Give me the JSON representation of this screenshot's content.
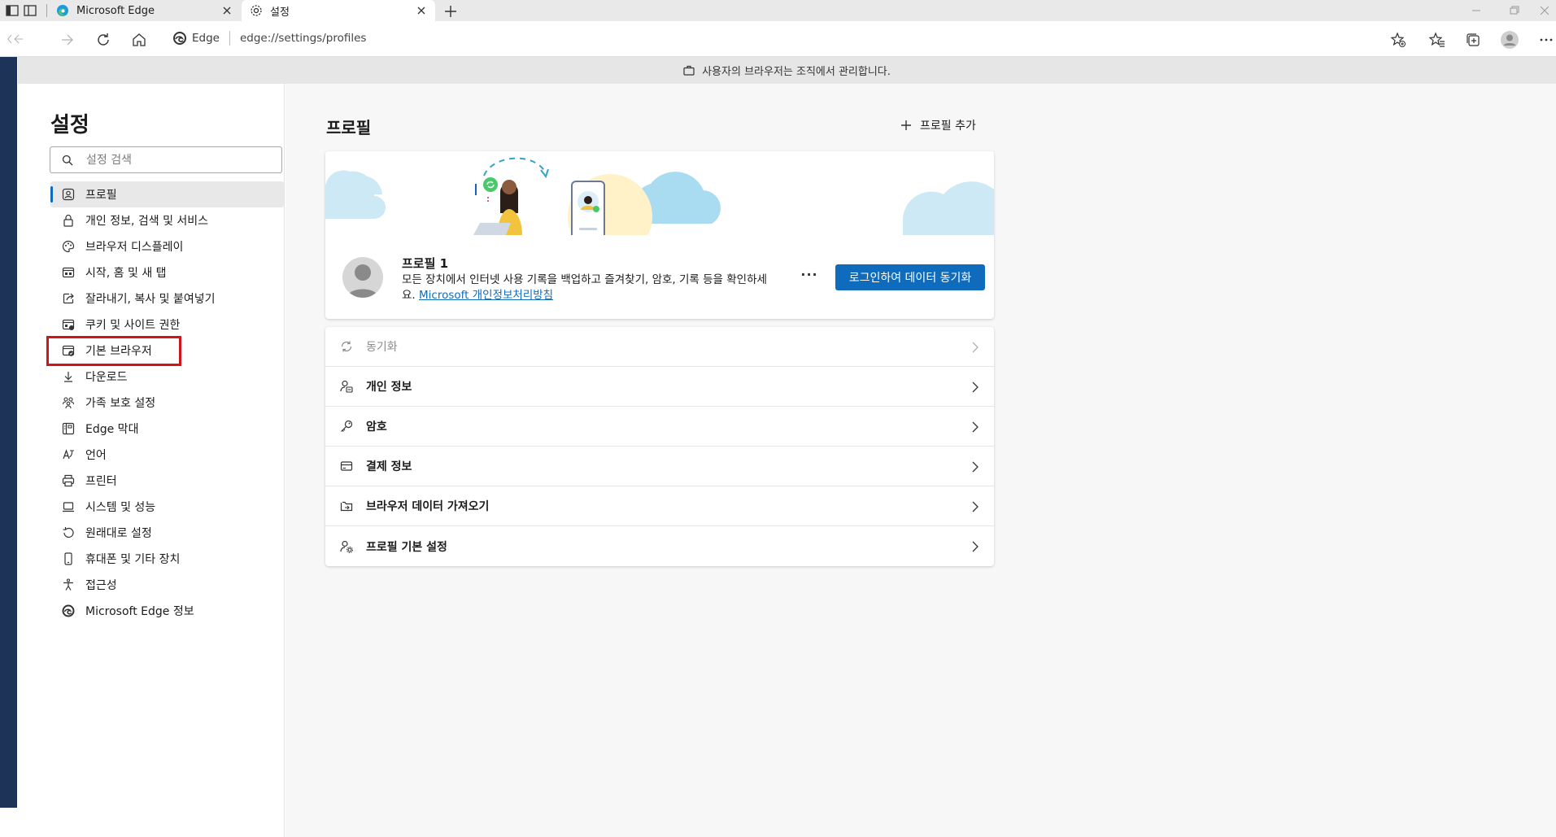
{
  "tabs": [
    {
      "title": "Microsoft Edge"
    },
    {
      "title": "설정"
    }
  ],
  "address": {
    "site": "Edge",
    "url": "edge://settings/profiles"
  },
  "managed_banner": "사용자의 브라우저는 조직에서 관리합니다.",
  "sidebar": {
    "title": "설정",
    "search_placeholder": "설정 검색",
    "items": [
      {
        "label": "프로필",
        "icon": "profile-icon"
      },
      {
        "label": "개인 정보, 검색 및 서비스",
        "icon": "lock-icon"
      },
      {
        "label": "브라우저 디스플레이",
        "icon": "appearance-icon"
      },
      {
        "label": "시작, 홈 및 새 탭",
        "icon": "start-page-icon"
      },
      {
        "label": "잘라내기, 복사 및 붙여넣기",
        "icon": "share-icon"
      },
      {
        "label": "쿠키 및 사이트 권한",
        "icon": "cookie-permissions-icon"
      },
      {
        "label": "기본 브라우저",
        "icon": "default-browser-icon"
      },
      {
        "label": "다운로드",
        "icon": "download-icon"
      },
      {
        "label": "가족 보호 설정",
        "icon": "family-icon"
      },
      {
        "label": "Edge 막대",
        "icon": "edge-bar-icon"
      },
      {
        "label": "언어",
        "icon": "language-icon"
      },
      {
        "label": "프린터",
        "icon": "printer-icon"
      },
      {
        "label": "시스템 및 성능",
        "icon": "laptop-icon"
      },
      {
        "label": "원래대로 설정",
        "icon": "reset-icon"
      },
      {
        "label": "휴대폰 및 기타 장치",
        "icon": "phone-icon"
      },
      {
        "label": "접근성",
        "icon": "accessibility-icon"
      },
      {
        "label": "Microsoft Edge 정보",
        "icon": "edge-logo-icon"
      }
    ]
  },
  "main": {
    "title": "프로필",
    "add_profile": "프로필 추가",
    "profile": {
      "name": "프로필 1",
      "description": "모든 장치에서 인터넷 사용 기록을 백업하고 즐겨찾기, 암호, 기록 등을 확인하세요.",
      "privacy_link": "Microsoft 개인정보처리방침",
      "more": "···",
      "sync_button": "로그인하여 데이터 동기화"
    },
    "rows": [
      {
        "label": "동기화",
        "icon": "sync-icon",
        "disabled": true
      },
      {
        "label": "개인 정보",
        "icon": "personal-info-icon"
      },
      {
        "label": "암호",
        "icon": "key-icon"
      },
      {
        "label": "결제 정보",
        "icon": "credit-card-icon"
      },
      {
        "label": "브라우저 데이터 가져오기",
        "icon": "import-icon"
      },
      {
        "label": "프로필 기본 설정",
        "icon": "profile-settings-icon"
      }
    ]
  },
  "colors": {
    "accent": "#0f6cbd",
    "highlight_box": "#d2141c",
    "left_edge": "#1e3358"
  }
}
